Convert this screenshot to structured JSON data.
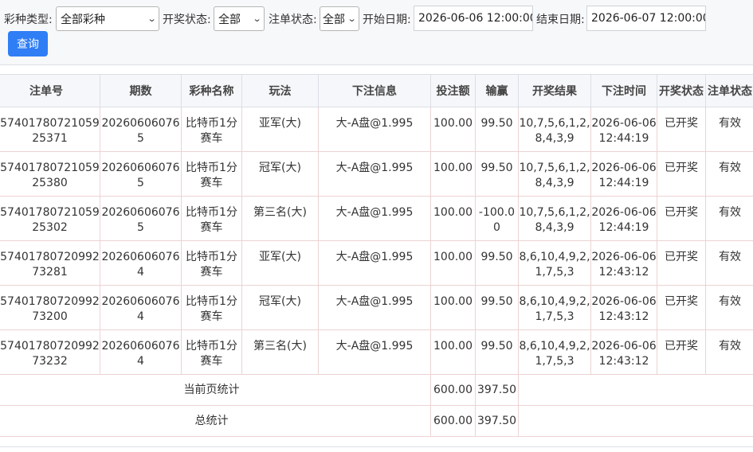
{
  "filters": {
    "lottery_type_label": "彩种类型:",
    "lottery_type_value": "全部彩种",
    "draw_status_label": "开奖状态:",
    "draw_status_value": "全部",
    "bet_status_label": "注单状态:",
    "bet_status_value": "全部",
    "start_date_label": "开始日期:",
    "start_date_value": "2026-06-06 12:00:00",
    "end_date_label": "结束日期:",
    "end_date_value": "2026-06-07 12:00:00",
    "query_button": "查询"
  },
  "table": {
    "headers": [
      "注单号",
      "期数",
      "彩种名称",
      "玩法",
      "下注信息",
      "投注额",
      "输赢",
      "开奖结果",
      "下注时间",
      "开奖状态",
      "注单状态"
    ],
    "rows": [
      [
        "5740178072105925371",
        "202606060765",
        "比特币1分赛车",
        "亚军(大)",
        "大-A盘@1.995",
        "100.00",
        "99.50",
        "10,7,5,6,1,2,8,4,3,9",
        "2026-06-06 12:44:19",
        "已开奖",
        "有效"
      ],
      [
        "5740178072105925380",
        "202606060765",
        "比特币1分赛车",
        "冠军(大)",
        "大-A盘@1.995",
        "100.00",
        "99.50",
        "10,7,5,6,1,2,8,4,3,9",
        "2026-06-06 12:44:19",
        "已开奖",
        "有效"
      ],
      [
        "5740178072105925302",
        "202606060765",
        "比特币1分赛车",
        "第三名(大)",
        "大-A盘@1.995",
        "100.00",
        "-100.00",
        "10,7,5,6,1,2,8,4,3,9",
        "2026-06-06 12:44:19",
        "已开奖",
        "有效"
      ],
      [
        "5740178072099273281",
        "202606060764",
        "比特币1分赛车",
        "亚军(大)",
        "大-A盘@1.995",
        "100.00",
        "99.50",
        "8,6,10,4,9,2,1,7,5,3",
        "2026-06-06 12:43:12",
        "已开奖",
        "有效"
      ],
      [
        "5740178072099273200",
        "202606060764",
        "比特币1分赛车",
        "冠军(大)",
        "大-A盘@1.995",
        "100.00",
        "99.50",
        "8,6,10,4,9,2,1,7,5,3",
        "2026-06-06 12:43:12",
        "已开奖",
        "有效"
      ],
      [
        "5740178072099273232",
        "202606060764",
        "比特币1分赛车",
        "第三名(大)",
        "大-A盘@1.995",
        "100.00",
        "99.50",
        "8,6,10,4,9,2,1,7,5,3",
        "2026-06-06 12:43:12",
        "已开奖",
        "有效"
      ]
    ],
    "summary": [
      {
        "label": "当前页统计",
        "bet_total": "600.00",
        "win_total": "397.50"
      },
      {
        "label": "总统计",
        "bet_total": "600.00",
        "win_total": "397.50"
      }
    ]
  },
  "colors": {
    "primary_button": "#2f7ef5",
    "header_bg": "#f5f7fa",
    "border": "#ecd3d3"
  }
}
